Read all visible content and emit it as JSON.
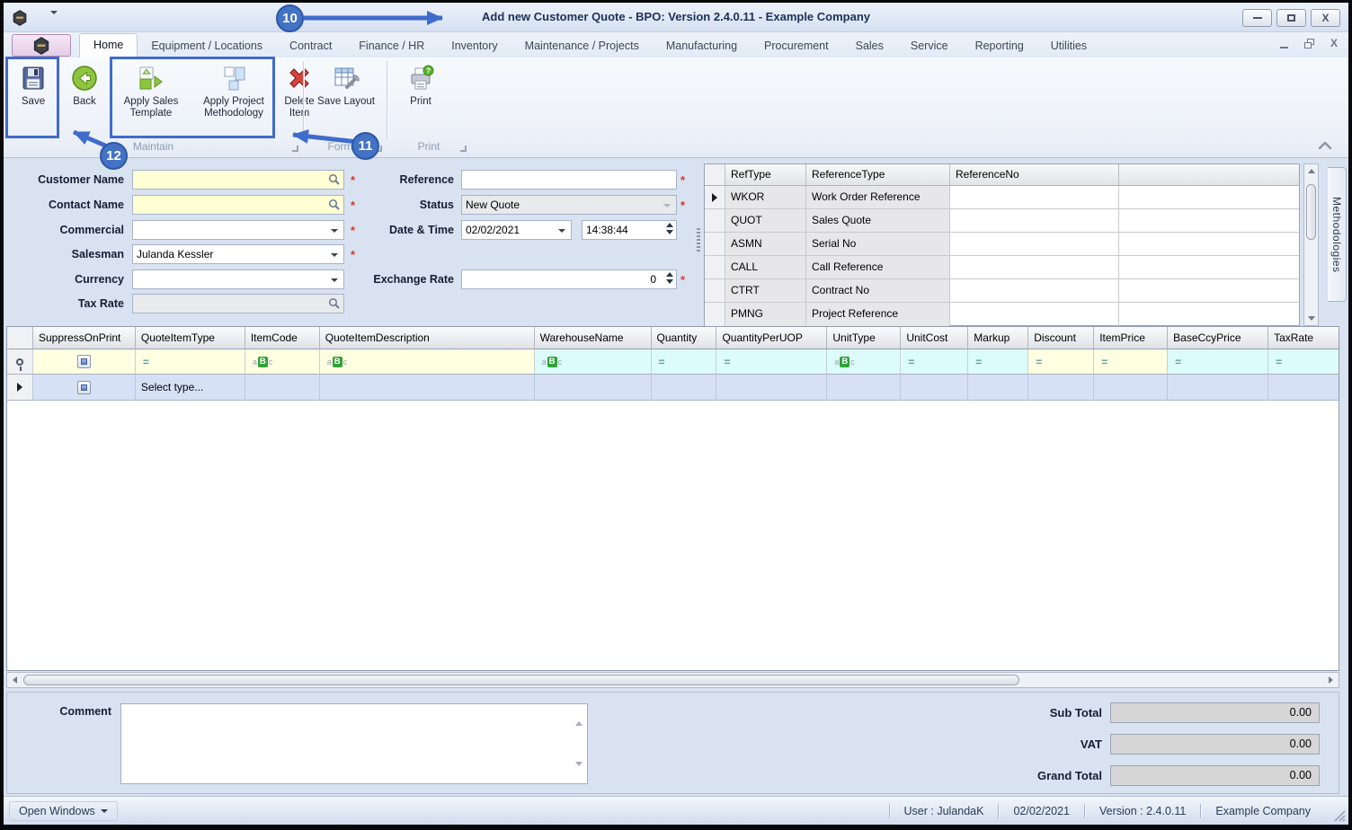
{
  "window": {
    "title": "Add new Customer Quote - BPO: Version 2.4.0.11 - Example Company"
  },
  "ribbon": {
    "tabs": [
      "Home",
      "Equipment / Locations",
      "Contract",
      "Finance / HR",
      "Inventory",
      "Maintenance / Projects",
      "Manufacturing",
      "Procurement",
      "Sales",
      "Service",
      "Reporting",
      "Utilities"
    ],
    "buttons": {
      "save": "Save",
      "back": "Back",
      "apply_sales_template": "Apply Sales Template",
      "apply_project_methodology": "Apply Project Methodology",
      "delete_item": "Delete Item",
      "save_layout": "Save Layout",
      "print": "Print"
    },
    "groups": [
      "Maintain",
      "Format",
      "Print"
    ]
  },
  "form": {
    "required_marker": "*",
    "left": [
      {
        "label": "Customer Name",
        "value": ""
      },
      {
        "label": "Contact Name",
        "value": ""
      },
      {
        "label": "Commercial",
        "value": ""
      },
      {
        "label": "Salesman",
        "value": "Julanda Kessler"
      },
      {
        "label": "Currency",
        "value": ""
      },
      {
        "label": "Tax Rate",
        "value": ""
      }
    ],
    "right": {
      "reference_label": "Reference",
      "reference_value": "",
      "status_label": "Status",
      "status_value": "New Quote",
      "datetime_label": "Date & Time",
      "date_value": "02/02/2021",
      "time_value": "14:38:44",
      "exchange_label": "Exchange Rate",
      "exchange_value": "0"
    }
  },
  "reference_grid": {
    "columns": [
      "RefType",
      "ReferenceType",
      "ReferenceNo"
    ],
    "rows": [
      {
        "ref_type": "WKOR",
        "reference_type": "Work Order Reference",
        "reference_no": ""
      },
      {
        "ref_type": "QUOT",
        "reference_type": "Sales Quote",
        "reference_no": ""
      },
      {
        "ref_type": "ASMN",
        "reference_type": "Serial No",
        "reference_no": ""
      },
      {
        "ref_type": "CALL",
        "reference_type": "Call Reference",
        "reference_no": ""
      },
      {
        "ref_type": "CTRT",
        "reference_type": "Contract No",
        "reference_no": ""
      },
      {
        "ref_type": "PMNG",
        "reference_type": "Project Reference",
        "reference_no": ""
      }
    ]
  },
  "side_panel": {
    "tab": "Methodologies"
  },
  "items_grid": {
    "columns": [
      "SuppressOnPrint",
      "QuoteItemType",
      "ItemCode",
      "QuoteItemDescription",
      "WarehouseName",
      "Quantity",
      "QuantityPerUOP",
      "UnitType",
      "UnitCost",
      "Markup",
      "Discount",
      "ItemPrice",
      "BaseCcyPrice",
      "TaxRate"
    ],
    "new_row": {
      "quote_item_type": "Select type..."
    },
    "filter_icons": {
      "equals": "=",
      "abc_a": "a",
      "abc_b": "B",
      "abc_c": "c"
    }
  },
  "footer": {
    "comment_label": "Comment",
    "comment_value": "",
    "totals": [
      {
        "label": "Sub Total",
        "value": "0.00"
      },
      {
        "label": "VAT",
        "value": "0.00"
      },
      {
        "label": "Grand Total",
        "value": "0.00"
      }
    ]
  },
  "status_bar": {
    "open_windows": "Open Windows",
    "user": "User : JulandaK",
    "date": "02/02/2021",
    "version": "Version : 2.4.0.11",
    "company": "Example Company"
  },
  "annotations": {
    "callout_10": "10",
    "callout_11": "11",
    "callout_12": "12"
  },
  "colors": {
    "annotation_blue": "#3F6BCB",
    "required_red": "#D23A32",
    "field_yellow": "#FFFFD4",
    "filter_yellow": "#FFFFE1",
    "filter_cyan": "#DCFBFB",
    "selected_row": "#D6E1F6"
  }
}
